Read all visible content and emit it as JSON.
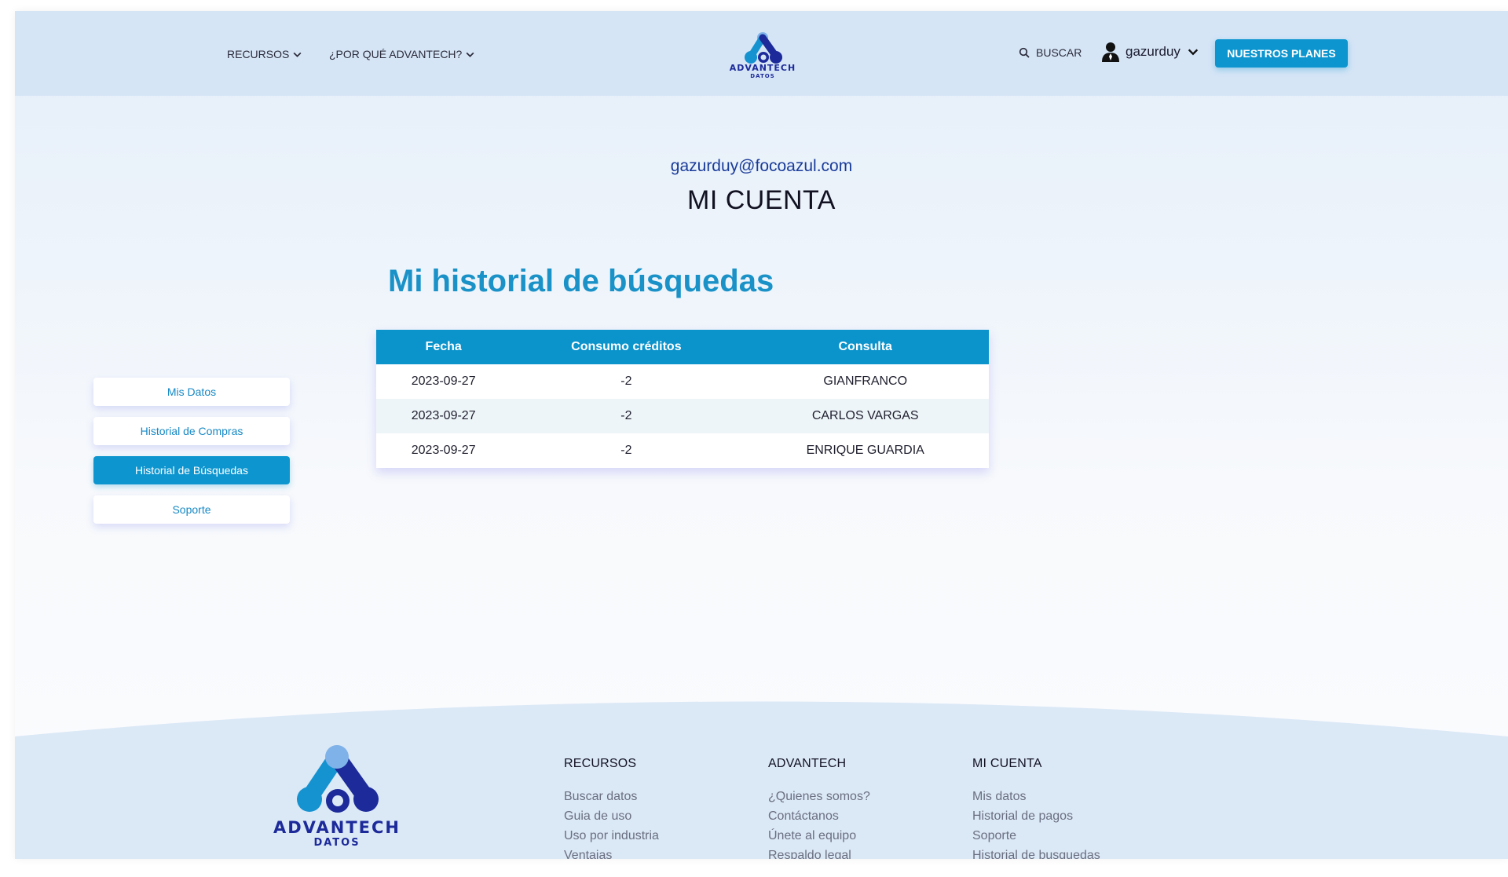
{
  "header": {
    "nav": [
      {
        "label": "RECURSOS"
      },
      {
        "label": "¿POR QUÉ ADVANTECH?"
      }
    ],
    "logo": {
      "brand": "ADVANTECH",
      "sub": "DATOS"
    },
    "search_label": "BUSCAR",
    "user": {
      "name": "gazurduy"
    },
    "plans_button": "NUESTROS PLANES"
  },
  "account": {
    "email": "gazurduy@focoazul.com",
    "title": "MI CUENTA"
  },
  "sidebar": {
    "items": [
      {
        "label": "Mis Datos",
        "active": false
      },
      {
        "label": "Historial de Compras",
        "active": false
      },
      {
        "label": "Historial de Búsquedas",
        "active": true
      },
      {
        "label": "Soporte",
        "active": false
      }
    ]
  },
  "history": {
    "title": "Mi historial de búsquedas",
    "columns": [
      "Fecha",
      "Consumo créditos",
      "Consulta"
    ],
    "rows": [
      [
        "2023-09-27",
        "-2",
        "GIANFRANCO"
      ],
      [
        "2023-09-27",
        "-2",
        "CARLOS VARGAS"
      ],
      [
        "2023-09-27",
        "-2",
        "ENRIQUE GUARDIA"
      ]
    ]
  },
  "footer": {
    "logo": {
      "brand": "ADVANTECH",
      "sub": "DATOS"
    },
    "columns": [
      {
        "title": "RECURSOS",
        "links": [
          "Buscar datos",
          "Guia de uso",
          "Uso por industria",
          "Ventajas"
        ]
      },
      {
        "title": "ADVANTECH",
        "links": [
          "¿Quienes somos?",
          "Contáctanos",
          "Únete al equipo",
          "Respaldo legal"
        ]
      },
      {
        "title": "MI CUENTA",
        "links": [
          "Mis datos",
          "Historial de pagos",
          "Soporte",
          "Historial de busquedas"
        ]
      }
    ]
  },
  "colors": {
    "accent": "#0d95cf",
    "brand_dark": "#1c2a9a",
    "header_bg": "#d5e5f6"
  },
  "icons": [
    "chevron-down-icon",
    "search-icon",
    "user-icon",
    "logo-icon"
  ]
}
